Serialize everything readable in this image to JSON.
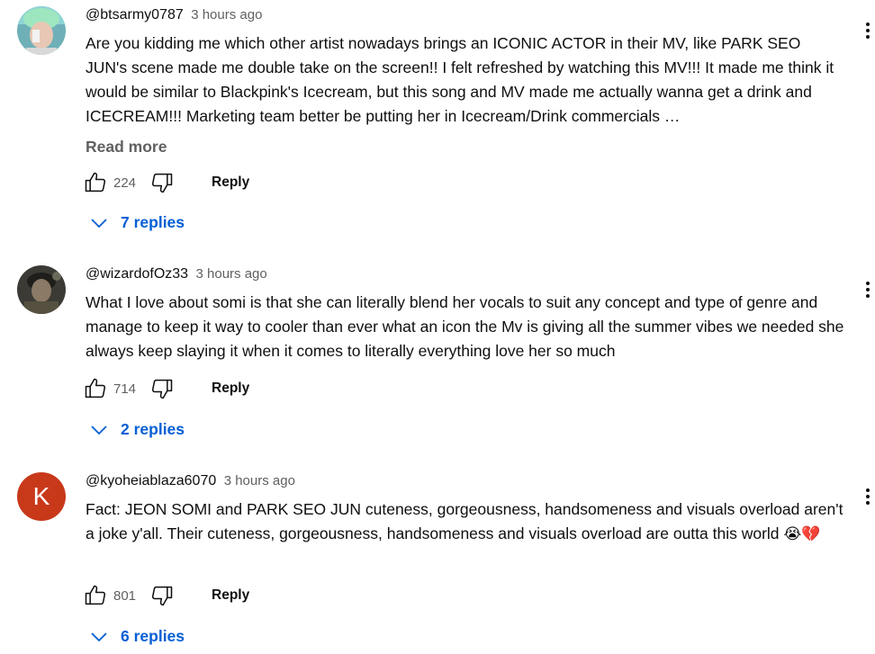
{
  "comments": [
    {
      "author": "@btsarmy0787",
      "time": "3 hours ago",
      "text": "Are you kidding me which other artist nowadays brings an ICONIC ACTOR in their MV, like PARK SEO JUN's scene made me double take on the screen!! I felt refreshed by watching this MV!!! It made me think it would be similar to Blackpink's Icecream, but this song and MV made me actually wanna get a drink and ICECREAM!!! Marketing team better be putting her in Icecream/Drink commercials …",
      "read_more": "Read more",
      "likes": "224",
      "reply_label": "Reply",
      "replies_label": "7 replies",
      "avatar": "photo"
    },
    {
      "author": "@wizardofOz33",
      "time": "3 hours ago",
      "text": "What I love about somi is that she can literally blend her vocals to suit any concept and type of genre and manage to keep it way to cooler than ever what an icon the Mv is giving all the summer vibes we needed she always keep slaying it when it comes to literally everything love her so much",
      "likes": "714",
      "reply_label": "Reply",
      "replies_label": "2 replies",
      "avatar": "photo"
    },
    {
      "author": "@kyoheiablaza6070",
      "time": "3 hours ago",
      "text": "Fact: JEON SOMI and PARK SEO JUN cuteness, gorgeousness, handsomeness and visuals overload aren't a joke y'all. Their cuteness, gorgeousness, handsomeness and visuals overload are outta this world",
      "emojis": "😭💔",
      "likes": "801",
      "reply_label": "Reply",
      "replies_label": "6 replies",
      "avatar_letter": "K",
      "avatar_color": "#c8391a"
    }
  ],
  "icons": {
    "like": "thumbs-up-icon",
    "dislike": "thumbs-down-icon",
    "expand": "chevron-down-icon",
    "menu": "more-vert-icon"
  }
}
